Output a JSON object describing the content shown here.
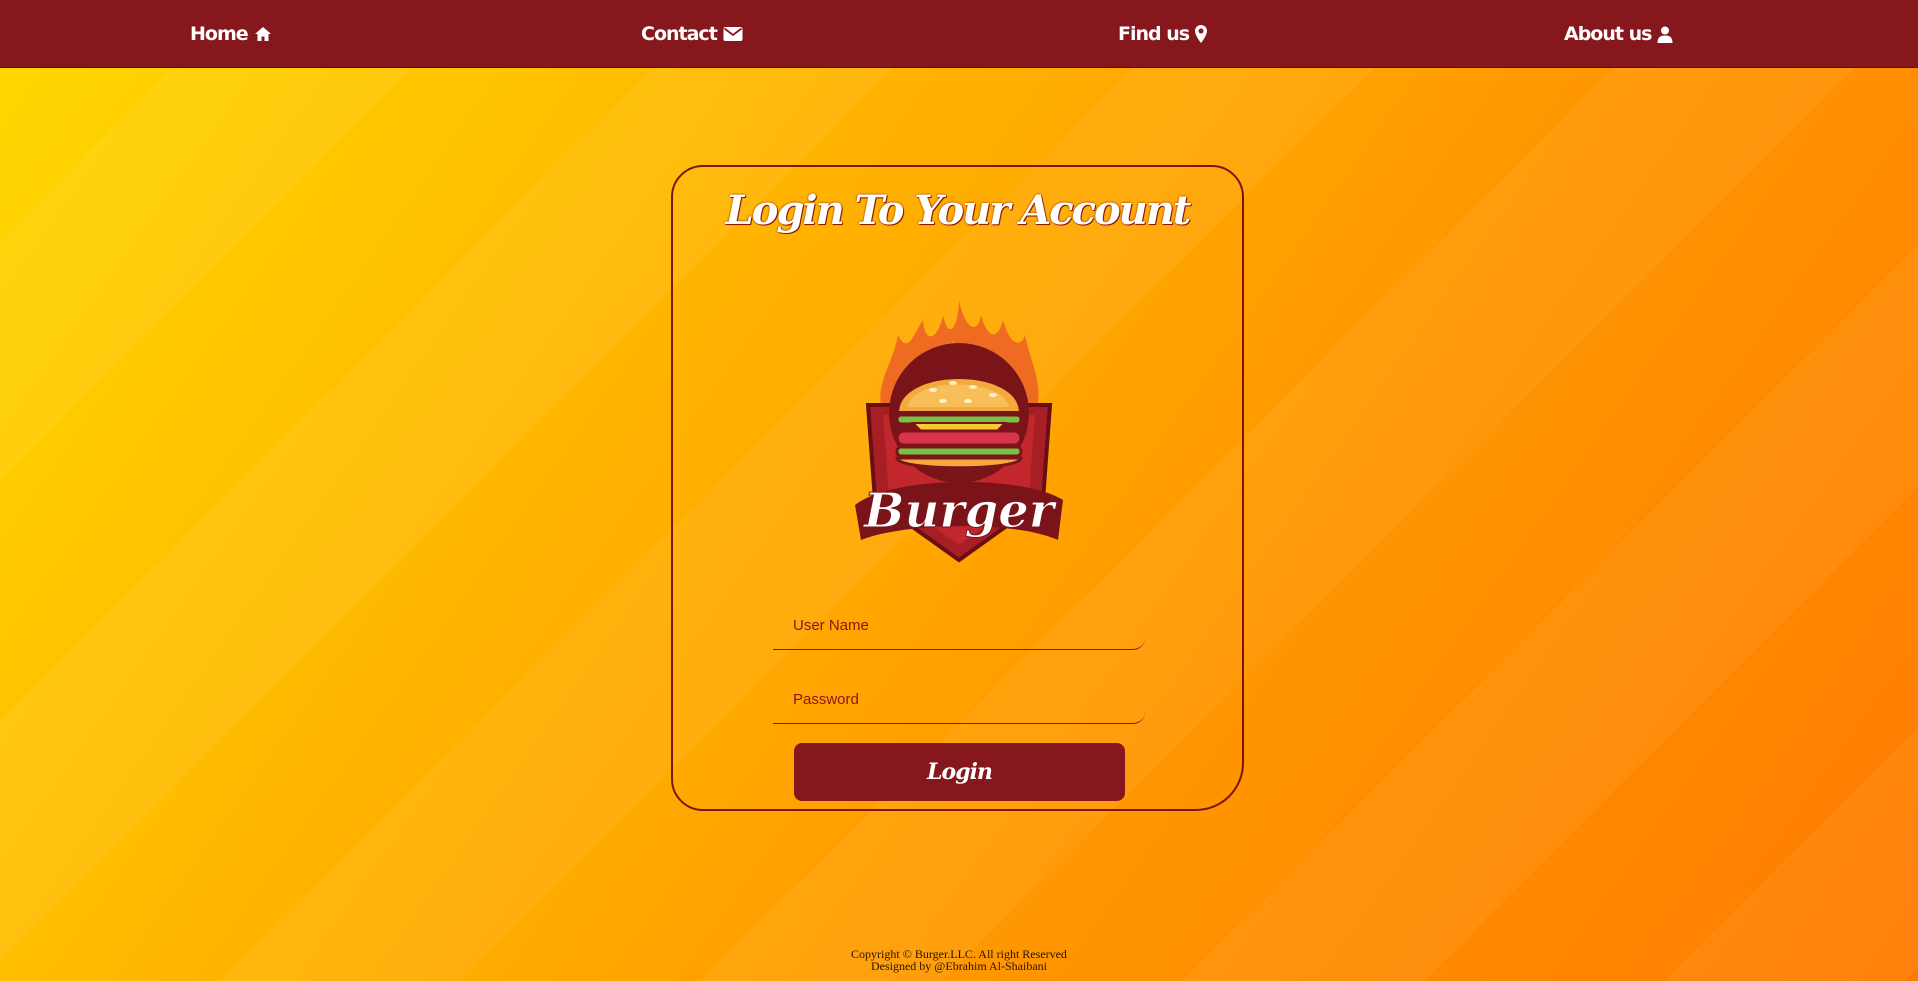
{
  "nav": {
    "home": "Home",
    "contact": "Contact",
    "find_us": "Find us",
    "about_us": "About us",
    "icons": [
      "home-icon",
      "envelope-icon",
      "map-marker-icon",
      "user-icon"
    ]
  },
  "login": {
    "title": "Login To Your Account",
    "logo_text": "Burger",
    "username_placeholder": "User Name",
    "username_value": "",
    "password_placeholder": "Password",
    "password_value": "",
    "button_label": "Login"
  },
  "footer": {
    "copyright": "Copyright © Burger.LLC. All right Reserved",
    "designer": "Designed by @Ebrahim Al-Shaibani"
  },
  "colors": {
    "nav_background": "#86171c",
    "accent": "#86171c",
    "gradient_start": "#ffd900",
    "gradient_end": "#ff7a00"
  }
}
